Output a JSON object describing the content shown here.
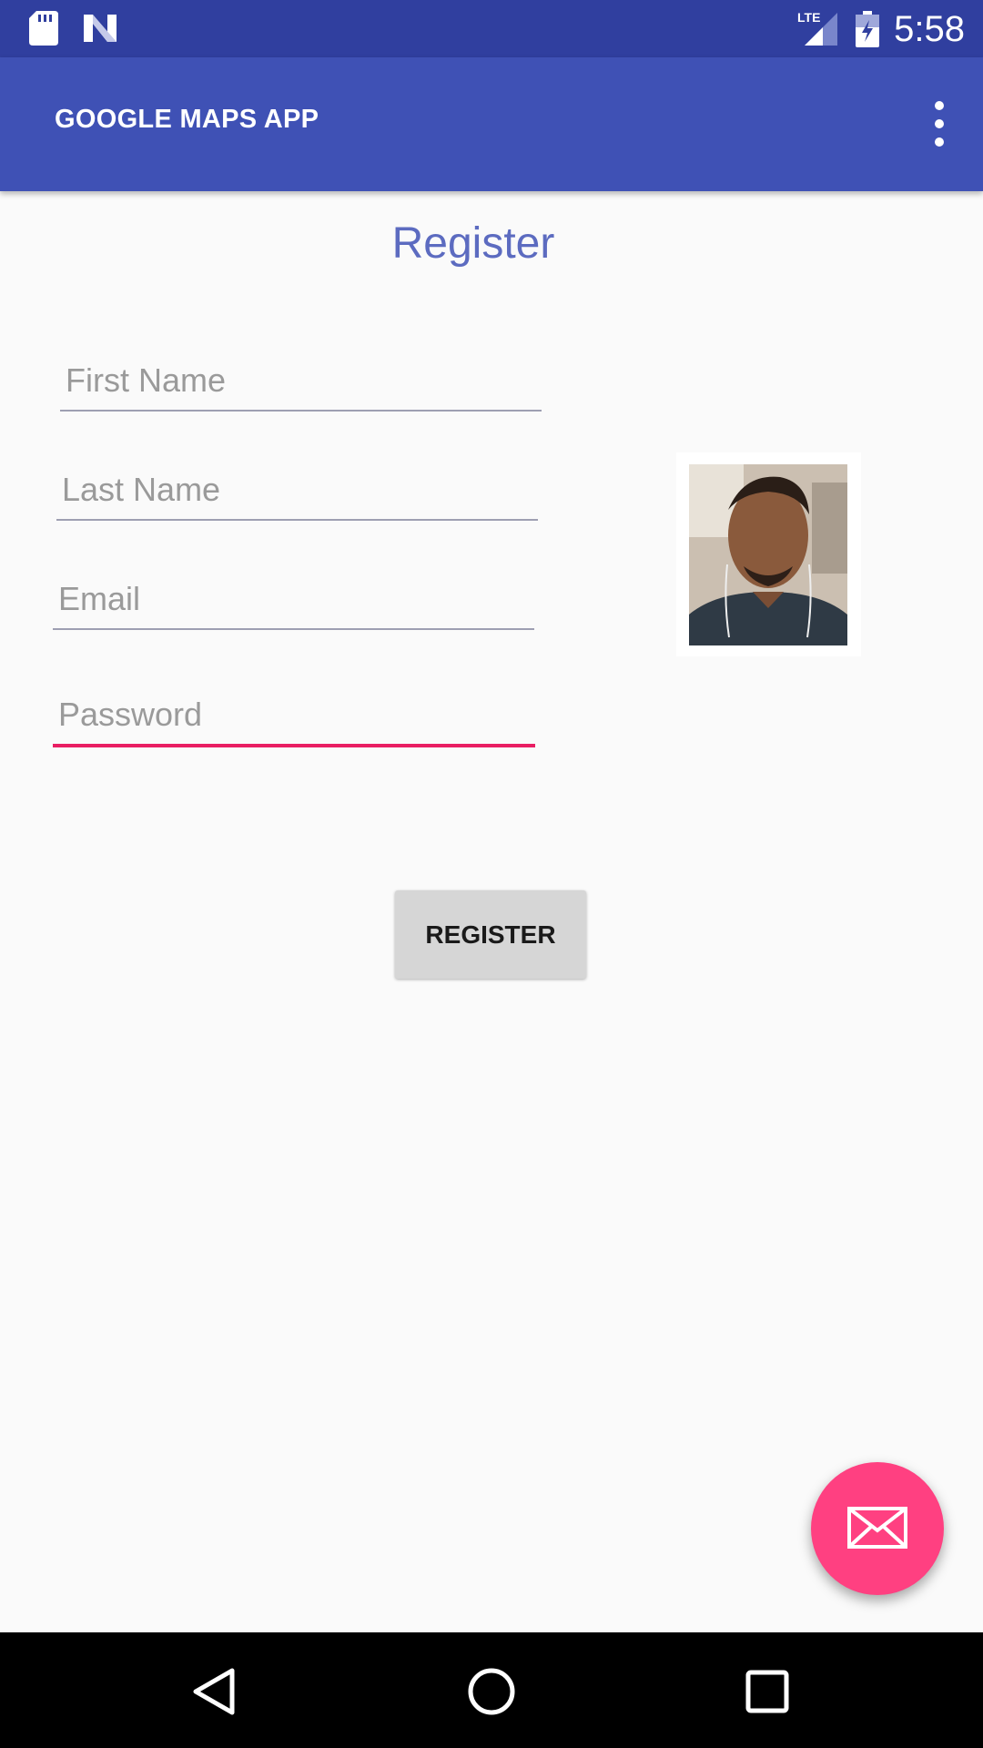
{
  "status_bar": {
    "time": "5:58",
    "network": "LTE",
    "icons": [
      "sd-card-icon",
      "n-logo-icon",
      "signal-icon",
      "battery-charging-icon"
    ]
  },
  "app_bar": {
    "title": "GOOGLE MAPS APP",
    "menu_icon": "more-vert-icon"
  },
  "form": {
    "heading": "Register",
    "first_name_placeholder": "First Name",
    "last_name_placeholder": "Last Name",
    "email_placeholder": "Email",
    "password_placeholder": "Password",
    "submit_label": "REGISTER"
  },
  "fab": {
    "icon": "mail-icon"
  },
  "nav_bar": {
    "icons": [
      "back-icon",
      "home-icon",
      "recents-icon"
    ]
  },
  "colors": {
    "status_bar": "#303f9f",
    "app_bar": "#3f51b5",
    "accent": "#ff4081",
    "focus_underline": "#e91e63",
    "heading": "#5c6bc0"
  }
}
